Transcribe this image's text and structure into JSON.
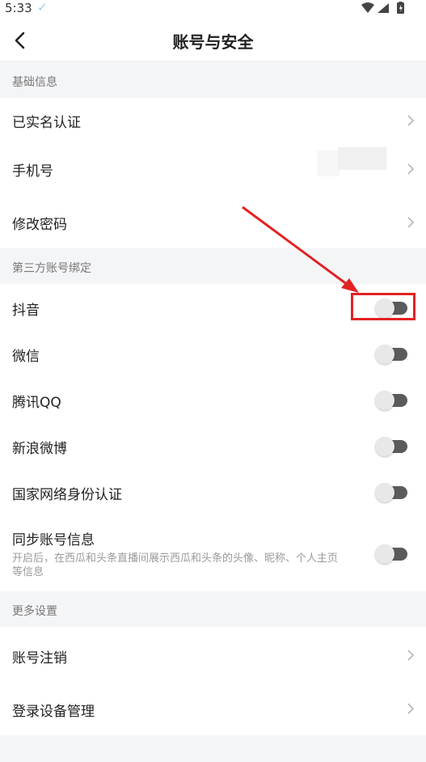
{
  "status": {
    "time": "5:33"
  },
  "nav": {
    "title": "账号与安全"
  },
  "sections": {
    "basic": {
      "header": "基础信息",
      "items": [
        {
          "label": "已实名认证"
        },
        {
          "label": "手机号"
        },
        {
          "label": "修改密码"
        }
      ]
    },
    "third_party": {
      "header": "第三方账号绑定",
      "items": [
        {
          "label": "抖音",
          "enabled": false
        },
        {
          "label": "微信",
          "enabled": false
        },
        {
          "label": "腾讯QQ",
          "enabled": false
        },
        {
          "label": "新浪微博",
          "enabled": false
        },
        {
          "label": "国家网络身份认证",
          "enabled": false
        },
        {
          "label": "同步账号信息",
          "description": "开启后，在西瓜和头条直播间展示西瓜和头条的头像、昵称、个人主页等信息",
          "enabled": false
        }
      ]
    },
    "more": {
      "header": "更多设置",
      "items": [
        {
          "label": "账号注销"
        },
        {
          "label": "登录设备管理"
        }
      ]
    }
  },
  "colors": {
    "highlight": "#e32222",
    "toggle_track": "#5b5b5b",
    "header_bg": "#f4f5f7"
  }
}
